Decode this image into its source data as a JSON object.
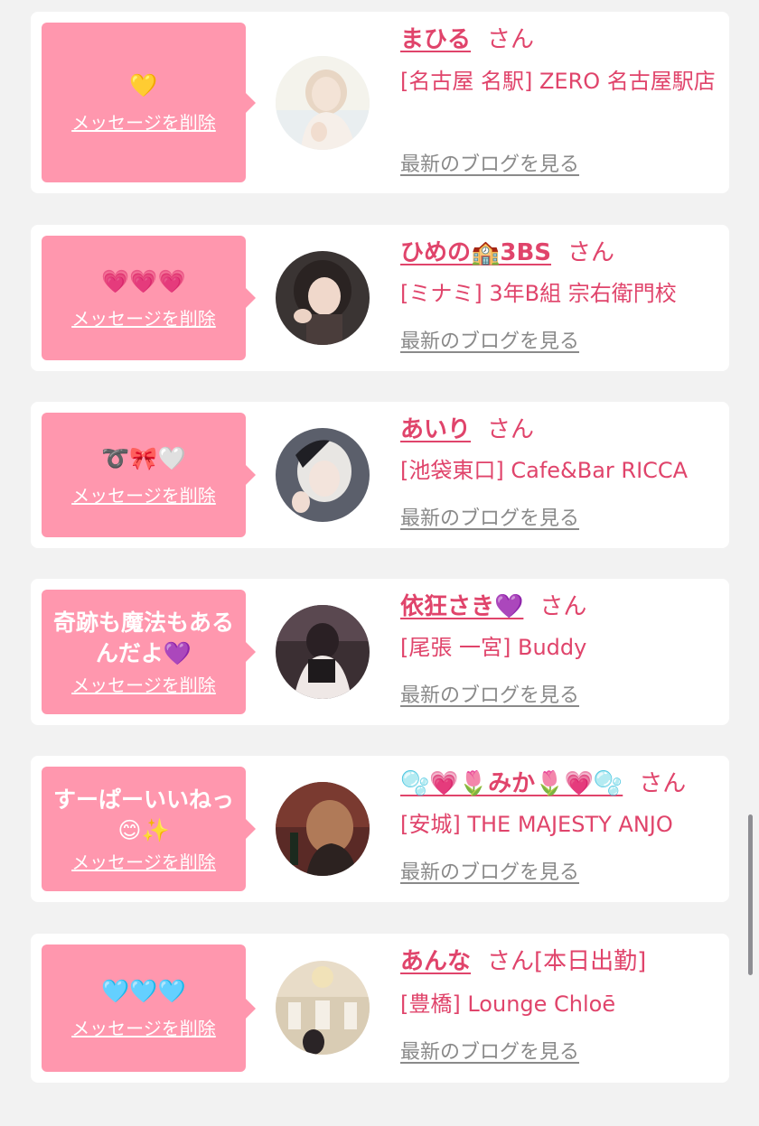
{
  "items": [
    {
      "message": "💛",
      "delete_label": "メッセージを削除",
      "name": "まひる",
      "honorific": "さん",
      "extra": "",
      "shop": "[名古屋 名駅] ZERO 名古屋駅店",
      "blog_link": "最新のブログを見る"
    },
    {
      "message": "💗💗💗",
      "delete_label": "メッセージを削除",
      "name": "ひめの🏫3BS",
      "honorific": "さん",
      "extra": "",
      "shop": "[ミナミ] 3年B組 宗右衛門校",
      "blog_link": "最新のブログを見る"
    },
    {
      "message": "➰🎀🤍",
      "delete_label": "メッセージを削除",
      "name": "あいり",
      "honorific": "さん",
      "extra": "",
      "shop": "[池袋東口] Cafe&Bar RICCA",
      "blog_link": "最新のブログを見る"
    },
    {
      "message": "奇跡も魔法もある\nんだよ💜",
      "delete_label": "メッセージを削除",
      "name": "依狂さき💜",
      "honorific": "さん",
      "extra": "",
      "shop": "[尾張 一宮] Buddy",
      "blog_link": "最新のブログを見る"
    },
    {
      "message": "すーぱーいいねっ\n😊✨",
      "delete_label": "メッセージを削除",
      "name": "🫧💗🌷みか🌷💗🫧",
      "honorific": "さん",
      "extra": "",
      "shop": "[安城] THE MAJESTY ANJO",
      "blog_link": "最新のブログを見る"
    },
    {
      "message": "🩵🩵🩵",
      "delete_label": "メッセージを削除",
      "name": "あんな",
      "honorific": "さん",
      "extra": "[本日出勤]",
      "shop": "[豊橋] Lounge Chloē",
      "blog_link": "最新のブログを見る"
    }
  ],
  "colors": {
    "background": "#f2f2f2",
    "bubble": "#ff97ae",
    "accent": "#e0446b",
    "link_gray": "#8a8a8a"
  }
}
